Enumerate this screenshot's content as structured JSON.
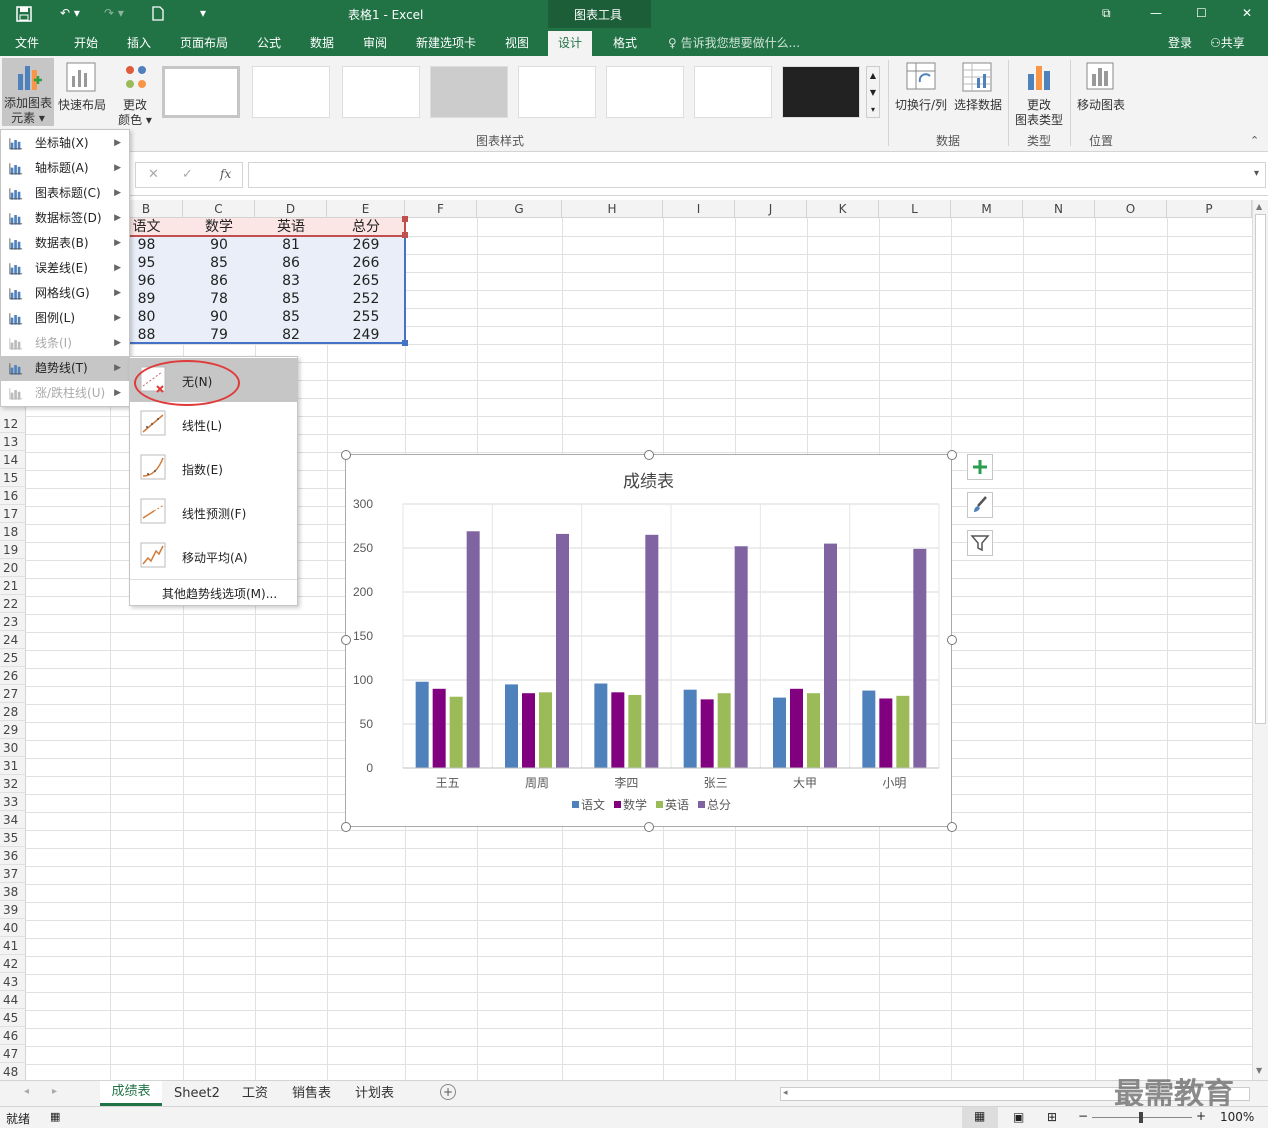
{
  "titlebar": {
    "title": "表格1 - Excel",
    "tool_context": "图表工具",
    "colors": {
      "brand": "#217346"
    }
  },
  "tabs": [
    "文件",
    "开始",
    "插入",
    "页面布局",
    "公式",
    "数据",
    "审阅",
    "新建选项卡",
    "视图",
    "设计",
    "格式"
  ],
  "tell_me": "告诉我您想要做什么...",
  "login": "登录",
  "share": "共享",
  "ribbon": {
    "add_element": [
      "添加图表",
      "元素"
    ],
    "quick_layout": "快速布局",
    "change_color": [
      "更改",
      "颜色"
    ],
    "chart_styles_label": "图表样式",
    "switch_rowcol": "切换行/列",
    "select_data": "选择数据",
    "data_label": "数据",
    "change_type": [
      "更改",
      "图表类型"
    ],
    "type_label": "类型",
    "move_chart": "移动图表",
    "location_label": "位置"
  },
  "formula": {
    "fx": "fx"
  },
  "columns": [
    "B",
    "C",
    "D",
    "E",
    "F",
    "G",
    "H",
    "I",
    "J",
    "K",
    "L",
    "M",
    "N",
    "O",
    "P"
  ],
  "rows": [
    "12",
    "13",
    "14",
    "15",
    "16",
    "17",
    "18",
    "19",
    "20",
    "21",
    "22",
    "23",
    "24",
    "25",
    "26",
    "27",
    "28",
    "29",
    "30",
    "31",
    "32",
    "33",
    "34",
    "35",
    "36",
    "37",
    "38",
    "39",
    "40",
    "41",
    "42",
    "43",
    "44",
    "45",
    "46",
    "47",
    "48"
  ],
  "table": {
    "headers": [
      "语文",
      "数学",
      "英语",
      "总分"
    ],
    "rows": [
      [
        "98",
        "90",
        "81",
        "269"
      ],
      [
        "95",
        "85",
        "86",
        "266"
      ],
      [
        "96",
        "86",
        "83",
        "265"
      ],
      [
        "89",
        "78",
        "85",
        "252"
      ],
      [
        "80",
        "90",
        "85",
        "255"
      ],
      [
        "88",
        "79",
        "82",
        "249"
      ]
    ]
  },
  "menu": {
    "items": [
      {
        "label": "坐标轴(X)",
        "disabled": false
      },
      {
        "label": "轴标题(A)",
        "disabled": false
      },
      {
        "label": "图表标题(C)",
        "disabled": false
      },
      {
        "label": "数据标签(D)",
        "disabled": false
      },
      {
        "label": "数据表(B)",
        "disabled": false
      },
      {
        "label": "误差线(E)",
        "disabled": false
      },
      {
        "label": "网格线(G)",
        "disabled": false
      },
      {
        "label": "图例(L)",
        "disabled": false
      },
      {
        "label": "线条(I)",
        "disabled": true
      },
      {
        "label": "趋势线(T)",
        "disabled": false
      },
      {
        "label": "涨/跌柱线(U)",
        "disabled": true
      }
    ],
    "submenu": [
      "无(N)",
      "线性(L)",
      "指数(E)",
      "线性预测(F)",
      "移动平均(A)"
    ],
    "more": "其他趋势线选项(M)..."
  },
  "chart_data": {
    "type": "bar",
    "title": "成绩表",
    "categories": [
      "王五",
      "周周",
      "李四",
      "张三",
      "大甲",
      "小明"
    ],
    "series": [
      {
        "name": "语文",
        "values": [
          98,
          95,
          96,
          89,
          80,
          88
        ],
        "color": "#4f81bd"
      },
      {
        "name": "数学",
        "values": [
          90,
          85,
          86,
          78,
          90,
          79
        ],
        "color": "#800080"
      },
      {
        "name": "英语",
        "values": [
          81,
          86,
          83,
          85,
          85,
          82
        ],
        "color": "#9bbb59"
      },
      {
        "name": "总分",
        "values": [
          269,
          266,
          265,
          252,
          255,
          249
        ],
        "color": "#8064a2"
      }
    ],
    "ylim": [
      0,
      300
    ],
    "yticks": [
      "0",
      "50",
      "100",
      "150",
      "200",
      "250",
      "300"
    ],
    "grid": true,
    "legend": "bottom"
  },
  "sheets": [
    "成绩表",
    "Sheet2",
    "工资",
    "销售表",
    "计划表"
  ],
  "status": {
    "ready": "就绪",
    "zoom": "100%"
  },
  "watermark": "最需教育"
}
